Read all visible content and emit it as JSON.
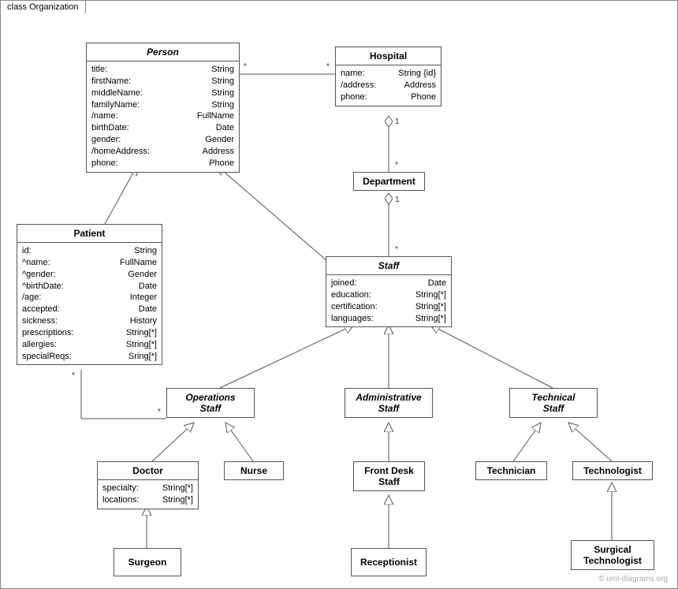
{
  "frame": {
    "title": "class Organization"
  },
  "classes": {
    "person": {
      "name": "Person",
      "attrs": [
        [
          "title:",
          "String"
        ],
        [
          "firstName:",
          "String"
        ],
        [
          "middleName:",
          "String"
        ],
        [
          "familyName:",
          "String"
        ],
        [
          "/name:",
          "FullName"
        ],
        [
          "birthDate:",
          "Date"
        ],
        [
          "gender:",
          "Gender"
        ],
        [
          "/homeAddress:",
          "Address"
        ],
        [
          "phone:",
          "Phone"
        ]
      ]
    },
    "hospital": {
      "name": "Hospital",
      "attrs": [
        [
          "name:",
          "String {id}"
        ],
        [
          "/address:",
          "Address"
        ],
        [
          "phone:",
          "Phone"
        ]
      ]
    },
    "department": {
      "name": "Department"
    },
    "patient": {
      "name": "Patient",
      "attrs": [
        [
          "id:",
          "String"
        ],
        [
          "^name:",
          "FullName"
        ],
        [
          "^gender:",
          "Gender"
        ],
        [
          "^birthDate:",
          "Date"
        ],
        [
          "/age:",
          "Integer"
        ],
        [
          "accepted:",
          "Date"
        ],
        [
          "sickness:",
          "History"
        ],
        [
          "prescriptions:",
          "String[*]"
        ],
        [
          "allergies:",
          "String[*]"
        ],
        [
          "specialReqs:",
          "Sring[*]"
        ]
      ]
    },
    "staff": {
      "name": "Staff",
      "attrs": [
        [
          "joined:",
          "Date"
        ],
        [
          "education:",
          "String[*]"
        ],
        [
          "certification:",
          "String[*]"
        ],
        [
          "languages:",
          "String[*]"
        ]
      ]
    },
    "operationsStaff": {
      "name1": "Operations",
      "name2": "Staff"
    },
    "administrativeStaff": {
      "name1": "Administrative",
      "name2": "Staff"
    },
    "technicalStaff": {
      "name1": "Technical",
      "name2": "Staff"
    },
    "doctor": {
      "name": "Doctor",
      "attrs": [
        [
          "specialty:",
          "String[*]"
        ],
        [
          "locations:",
          "String[*]"
        ]
      ]
    },
    "nurse": {
      "name": "Nurse"
    },
    "frontDeskStaff": {
      "name1": "Front Desk",
      "name2": "Staff"
    },
    "technician": {
      "name": "Technician"
    },
    "technologist": {
      "name": "Technologist"
    },
    "surgeon": {
      "name": "Surgeon"
    },
    "receptionist": {
      "name": "Receptionist"
    },
    "surgicalTechnologist": {
      "name1": "Surgical",
      "name2": "Technologist"
    }
  },
  "multiplicities": {
    "personHospital_left": "*",
    "personHospital_right": "*",
    "hospitalDept_top": "1",
    "hospitalDept_bottom": "*",
    "deptStaff_top": "1",
    "deptStaff_bottom": "*",
    "patientOps_left": "*",
    "patientOps_right": "*"
  },
  "watermark": "© uml-diagrams.org"
}
